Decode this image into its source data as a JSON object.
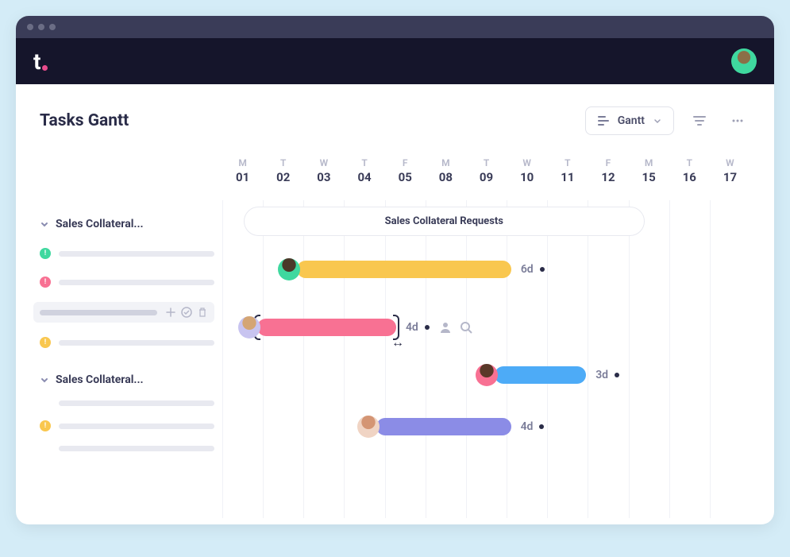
{
  "logo": "t",
  "pageTitle": "Tasks Gantt",
  "viewSelector": {
    "label": "Gantt"
  },
  "timeline": {
    "days": [
      {
        "letter": "M",
        "num": "01"
      },
      {
        "letter": "T",
        "num": "02"
      },
      {
        "letter": "W",
        "num": "03"
      },
      {
        "letter": "T",
        "num": "04"
      },
      {
        "letter": "F",
        "num": "05"
      },
      {
        "letter": "M",
        "num": "08"
      },
      {
        "letter": "T",
        "num": "09"
      },
      {
        "letter": "W",
        "num": "10"
      },
      {
        "letter": "T",
        "num": "11"
      },
      {
        "letter": "F",
        "num": "12"
      },
      {
        "letter": "M",
        "num": "15"
      },
      {
        "letter": "T",
        "num": "16"
      },
      {
        "letter": "W",
        "num": "17"
      }
    ]
  },
  "groups": [
    {
      "name": "Sales Collateral..."
    },
    {
      "name": "Sales Collateral..."
    }
  ],
  "ganttGroupLabel": "Sales Collateral Requests",
  "bars": [
    {
      "duration": "6d"
    },
    {
      "duration": "4d"
    },
    {
      "duration": "3d"
    },
    {
      "duration": "4d"
    }
  ]
}
